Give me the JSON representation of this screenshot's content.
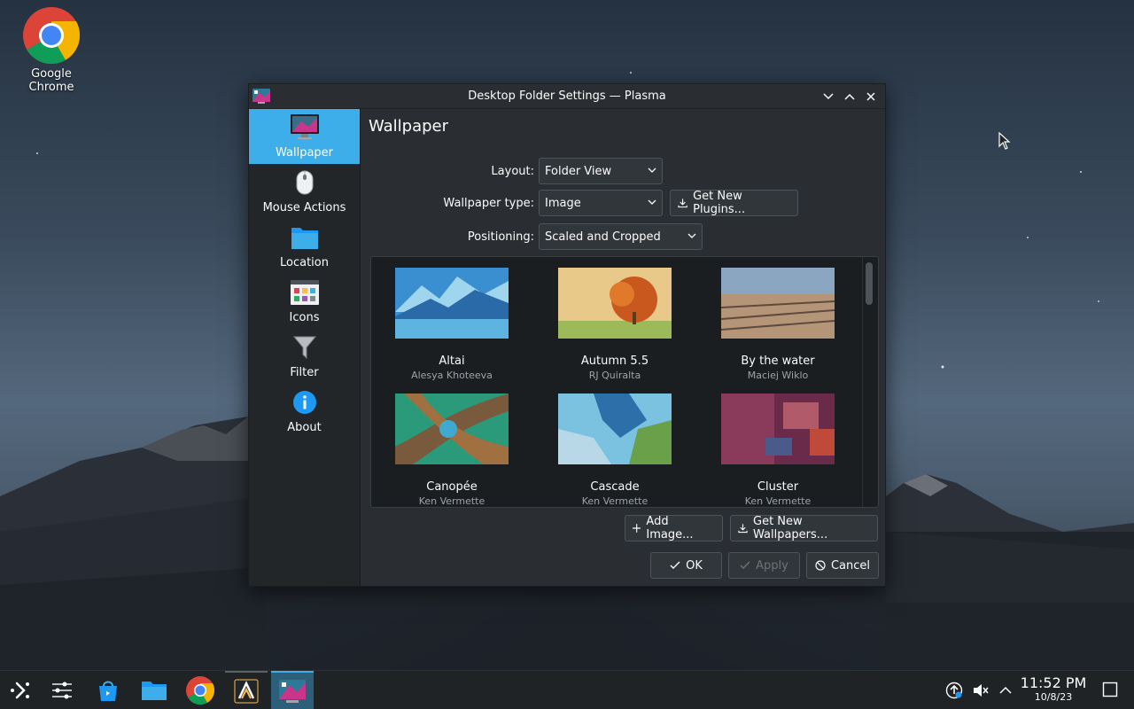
{
  "desktop": {
    "icons": [
      {
        "label": "Google Chrome",
        "icon": "chrome-icon"
      }
    ]
  },
  "window": {
    "title": "Desktop Folder Settings — Plasma",
    "controls": [
      "minimize-icon",
      "maximize-icon",
      "close-icon"
    ]
  },
  "sidebar": {
    "items": [
      {
        "label": "Wallpaper",
        "icon": "monitor-icon",
        "active": true
      },
      {
        "label": "Mouse Actions",
        "icon": "mouse-icon",
        "active": false
      },
      {
        "label": "Location",
        "icon": "folder-icon",
        "active": false
      },
      {
        "label": "Icons",
        "icon": "icons-icon",
        "active": false
      },
      {
        "label": "Filter",
        "icon": "filter-icon",
        "active": false
      },
      {
        "label": "About",
        "icon": "info-icon",
        "active": false
      }
    ]
  },
  "page": {
    "title": "Wallpaper",
    "layout_label": "Layout:",
    "layout_value": "Folder View",
    "type_label": "Wallpaper type:",
    "type_value": "Image",
    "get_plugins": "Get New Plugins...",
    "positioning_label": "Positioning:",
    "positioning_value": "Scaled and Cropped"
  },
  "wallpapers": [
    {
      "name": "Altai",
      "author": "Alesya Khoteeva"
    },
    {
      "name": "Autumn 5.5",
      "author": "RJ Quiralta"
    },
    {
      "name": "By the water",
      "author": "Maciej Wiklo"
    },
    {
      "name": "Canopée",
      "author": "Ken Vermette"
    },
    {
      "name": "Cascade",
      "author": "Ken Vermette"
    },
    {
      "name": "Cluster",
      "author": "Ken Vermette"
    }
  ],
  "buttons": {
    "add_image": "Add Image...",
    "get_wallpapers": "Get New Wallpapers...",
    "ok": "OK",
    "apply": "Apply",
    "cancel": "Cancel"
  },
  "taskbar": {
    "time": "11:52 PM",
    "date": "10/8/23",
    "items": [
      "app-launcher-icon",
      "overview-icon",
      "discover-icon",
      "dolphin-icon",
      "chrome-icon",
      "text-editor-icon",
      "system-settings-icon"
    ],
    "tray": [
      "updates-icon",
      "volume-muted-icon",
      "expand-tray-icon",
      "show-desktop-icon"
    ]
  },
  "colors": {
    "accent": "#3daee9",
    "window_bg": "#2a2e32",
    "sidebar_bg": "#232629"
  }
}
